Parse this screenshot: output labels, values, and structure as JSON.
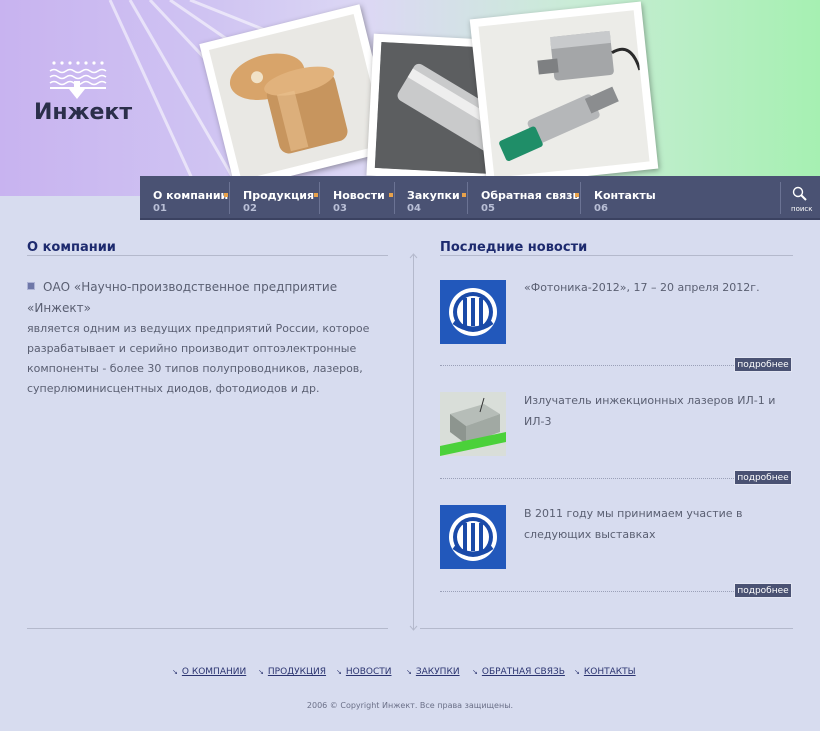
{
  "brand": {
    "logo_text": "Инжект"
  },
  "nav": {
    "items": [
      {
        "label": "О компании",
        "num": "01"
      },
      {
        "label": "Продукция",
        "num": "02"
      },
      {
        "label": "Новости",
        "num": "03"
      },
      {
        "label": "Закупки",
        "num": "04"
      },
      {
        "label": "Обратная связь",
        "num": "05"
      },
      {
        "label": "Контакты",
        "num": "06"
      }
    ],
    "search_label": "поиск"
  },
  "about": {
    "title": "О компании",
    "line1": "ОАО «Научно-производственное предприятие «Инжект»",
    "rest": "является одним из ведущих предприятий России, которое разрабатывает и серийно производит оптоэлектронные компоненты -  более 30 типов полупроводников, лазеров, суперлюминисцентных диодов, фотодиодов и др."
  },
  "news": {
    "title": "Последние новости",
    "items": [
      {
        "text": "«Фотоника-2012», 17 – 20 апреля 2012г.",
        "image": "fotonika-logo",
        "more": "подробнее"
      },
      {
        "text": "Излучатель инжекционных лазеров ИЛ-1 и ИЛ-3",
        "image": "laser-emitter-photo",
        "more": "подробнее"
      },
      {
        "text": "В 2011 году мы принимаем участие в следующих выставках",
        "image": "fotonika-logo",
        "more": "подробнее"
      }
    ]
  },
  "footer": {
    "links": [
      "О КОМПАНИИ",
      "ПРОДУКЦИЯ",
      "НОВОСТИ",
      "ЗАКУПКИ",
      "ОБРАТНАЯ СВЯЗЬ",
      "КОНТАКТЫ"
    ],
    "copyright": "2006 © Copyright Инжект. Все права защищены."
  },
  "colors": {
    "nav_bg": "#4a5273",
    "title": "#1d2a6e",
    "accent_dot": "#e8a24b",
    "page_bg": "#d7dcef"
  }
}
